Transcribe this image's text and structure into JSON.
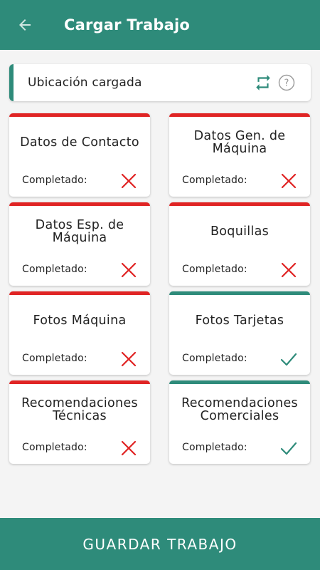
{
  "appbar": {
    "title": "Cargar Trabajo",
    "back_icon": "arrow-left-icon"
  },
  "location": {
    "label": "Ubicación cargada",
    "refresh_icon": "refresh-icon",
    "help_icon": "help-circle-icon",
    "accent_color": "#2e8b7a"
  },
  "colors": {
    "primary": "#2e8b7a",
    "incomplete": "#e02424",
    "complete": "#2e8b7a"
  },
  "sections": [
    {
      "title": "Datos de Contacto",
      "status_label": "Completado:",
      "completed": false
    },
    {
      "title": "Datos Gen. de Máquina",
      "status_label": "Completado:",
      "completed": false
    },
    {
      "title": "Datos Esp. de Máquina",
      "status_label": "Completado:",
      "completed": false
    },
    {
      "title": "Boquillas",
      "status_label": "Completado:",
      "completed": false
    },
    {
      "title": "Fotos Máquina",
      "status_label": "Completado:",
      "completed": false
    },
    {
      "title": "Fotos Tarjetas",
      "status_label": "Completado:",
      "completed": true
    },
    {
      "title": "Recomendaciones Técnicas",
      "status_label": "Completado:",
      "completed": false
    },
    {
      "title": "Recomendaciones Comerciales",
      "status_label": "Completado:",
      "completed": true
    }
  ],
  "footer": {
    "save_label": "GUARDAR TRABAJO"
  }
}
